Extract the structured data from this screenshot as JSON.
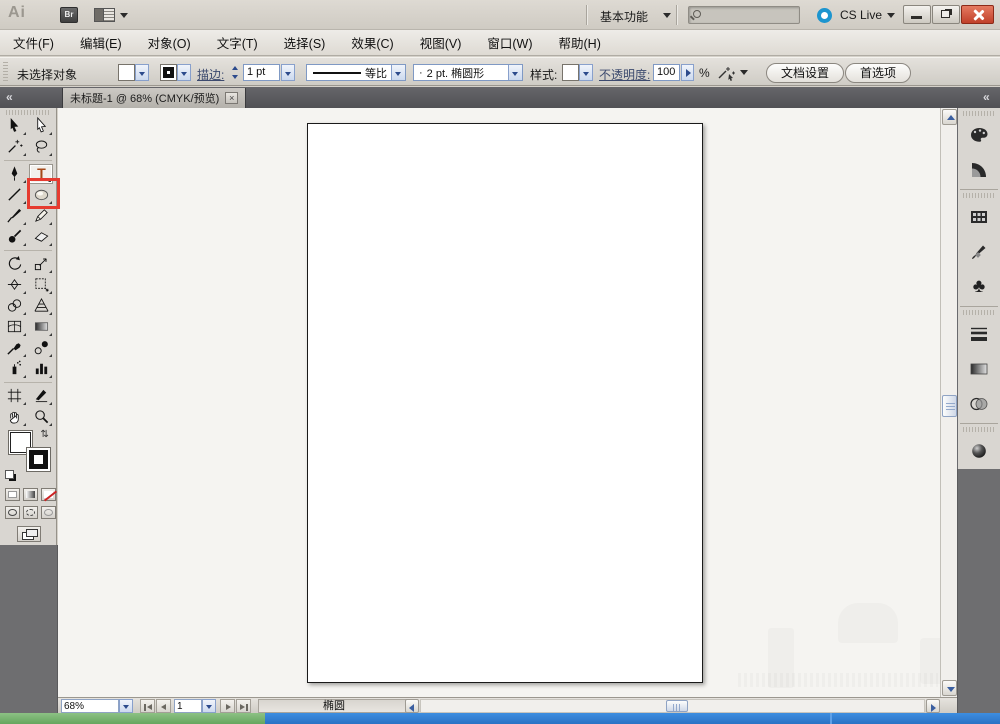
{
  "titlebar": {
    "logo": "Ai",
    "bridge": "Br",
    "workspace": "基本功能",
    "search_value": "",
    "cs_live": "CS Live"
  },
  "menubar": {
    "items": [
      "文件(F)",
      "编辑(E)",
      "对象(O)",
      "文字(T)",
      "选择(S)",
      "效果(C)",
      "视图(V)",
      "窗口(W)",
      "帮助(H)"
    ]
  },
  "controlbar": {
    "selection_status": "未选择对象",
    "stroke_link": "描边:",
    "stroke_weight": "1 pt",
    "profile": "等比",
    "brush_dot": "·",
    "brush": "2 pt. 椭圆形",
    "style_label": "样式:",
    "opacity_link": "不透明度:",
    "opacity_value": "100",
    "percent": "%",
    "doc_setup": "文档设置",
    "preferences": "首选项"
  },
  "document_tab": {
    "title": "未标题-1 @ 68% (CMYK/预览)",
    "close_glyph": "×"
  },
  "chrome": {
    "collapse_glyph": "«"
  },
  "toolbox": {
    "type_glyph": "T",
    "tools": [
      "selection",
      "direct-selection",
      "magic-wand",
      "lasso",
      "pen",
      "type",
      "line-segment",
      "ellipse",
      "paintbrush",
      "pencil",
      "blob-brush",
      "eraser",
      "rotate",
      "scale",
      "width",
      "free-transform",
      "shape-builder",
      "perspective-grid",
      "mesh",
      "gradient",
      "eyedropper",
      "blend",
      "symbol-sprayer",
      "column-graph",
      "artboard",
      "slice",
      "hand",
      "zoom"
    ],
    "highlighted_tool": "ellipse"
  },
  "panels": {
    "symbols_glyph": "♣",
    "items": [
      "color",
      "color-guide",
      "swatches",
      "brushes",
      "symbols",
      "stroke",
      "gradient",
      "transparency",
      "appearance",
      "graphic-styles",
      "layers",
      "artboards",
      "transform",
      "align",
      "pathfinder"
    ]
  },
  "statusbar": {
    "zoom": "68%",
    "artboard": "1",
    "status": "椭圆"
  },
  "colors": {
    "highlight_red": "#e63b30",
    "close_red": "#c0402a",
    "taskbar_green": "#72ad6a",
    "taskbar_blue": "#2f7fd2",
    "tabbar_dark": "#56565a"
  }
}
